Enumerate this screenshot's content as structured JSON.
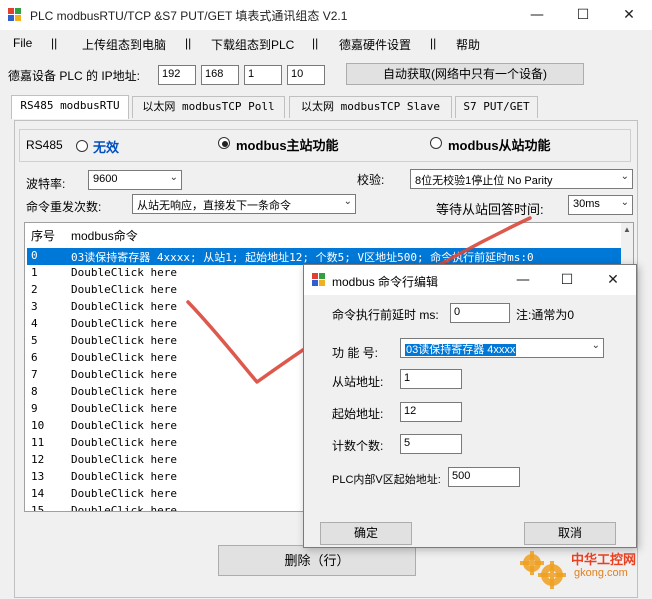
{
  "window": {
    "title": "PLC modbusRTU/TCP &S7 PUT/GET 填表式通讯组态  V2.1",
    "min_glyph": "—",
    "max_glyph": "☐",
    "close_glyph": "✕"
  },
  "menu": [
    "File",
    "||",
    "上传组态到电脑",
    "||",
    "下载组态到PLC",
    "||",
    "德嘉硬件设置",
    "||",
    "帮助"
  ],
  "ip": {
    "label": "德嘉设备 PLC 的 IP地址:",
    "octets": [
      "192",
      "168",
      "1",
      "10"
    ],
    "auto_button": "自动获取(网络中只有一个设备)"
  },
  "tabs": [
    "RS485 modbusRTU",
    "以太网 modbusTCP Poll",
    "以太网 modbusTCP Slave",
    "S7 PUT/GET"
  ],
  "rs485": {
    "label": "RS485",
    "options": [
      "无效",
      "modbus主站功能",
      "modbus从站功能"
    ],
    "selected_index": 1
  },
  "settings": {
    "baud_label": "波特率:",
    "baud_value": "9600",
    "parity_label": "校验:",
    "parity_value": "8位无校验1停止位 No Parity",
    "retry_label": "命令重发次数:",
    "retry_value": "从站无响应，直接发下一条命令",
    "wait_label": "等待从站回答时间:",
    "wait_value": "30ms"
  },
  "table": {
    "headers": [
      "序号",
      "modbus命令"
    ],
    "rows": [
      {
        "n": "0",
        "cmd": "03读保持寄存器 4xxxx; 从站1; 起始地址12; 个数5; V区地址500; 命令执行前延时ms:0"
      },
      {
        "n": "1",
        "cmd": "DoubleClick here"
      },
      {
        "n": "2",
        "cmd": "DoubleClick here"
      },
      {
        "n": "3",
        "cmd": "DoubleClick here"
      },
      {
        "n": "4",
        "cmd": "DoubleClick here"
      },
      {
        "n": "5",
        "cmd": "DoubleClick here"
      },
      {
        "n": "6",
        "cmd": "DoubleClick here"
      },
      {
        "n": "7",
        "cmd": "DoubleClick here"
      },
      {
        "n": "8",
        "cmd": "DoubleClick here"
      },
      {
        "n": "9",
        "cmd": "DoubleClick here"
      },
      {
        "n": "10",
        "cmd": "DoubleClick here"
      },
      {
        "n": "11",
        "cmd": "DoubleClick here"
      },
      {
        "n": "12",
        "cmd": "DoubleClick here"
      },
      {
        "n": "13",
        "cmd": "DoubleClick here"
      },
      {
        "n": "14",
        "cmd": "DoubleClick here"
      },
      {
        "n": "15",
        "cmd": "DoubleClick here"
      }
    ],
    "selected_row": 0
  },
  "delete_button": "删除（行）",
  "dialog": {
    "title": "modbus 命令行编辑",
    "delay_label": "命令执行前延时 ms:",
    "delay_value": "0",
    "delay_note": "注:通常为0",
    "func_label": "功 能 号:",
    "func_value": "03读保持寄存器 4xxxx",
    "slave_label": "从站地址:",
    "slave_value": "1",
    "start_label": "起始地址:",
    "start_value": "12",
    "count_label": "计数个数:",
    "count_value": "5",
    "vaddr_label": "PLC内部V区起始地址:",
    "vaddr_value": "500",
    "ok_button": "确定",
    "cancel_button": "取消"
  },
  "watermark": {
    "text_cn": "中华工控网",
    "text_url": "gkong.com"
  },
  "colors": {
    "selection": "#0078d7",
    "check_mark": "#d9473a",
    "watermark": "#e8a020"
  }
}
